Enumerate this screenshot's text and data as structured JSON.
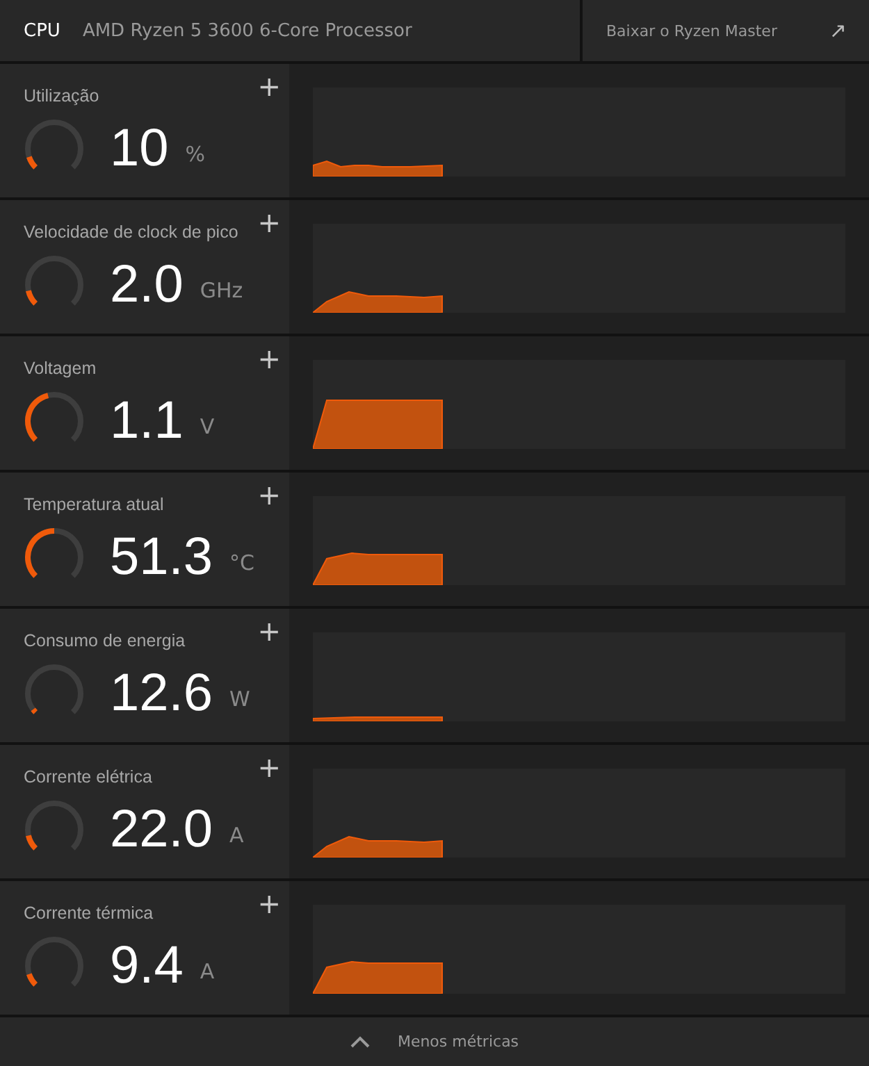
{
  "header": {
    "label": "CPU",
    "processor": "AMD Ryzen 5 3600 6-Core Processor",
    "link": "Baixar o Ryzen Master",
    "link_icon": "↗"
  },
  "metrics": [
    {
      "title": "Utilização",
      "value": "10",
      "unit": "%"
    },
    {
      "title": "Velocidade de clock de pico",
      "value": "2.0",
      "unit": "GHz"
    },
    {
      "title": "Voltagem",
      "value": "1.1",
      "unit": "V"
    },
    {
      "title": "Temperatura atual",
      "value": "51.3",
      "unit": "°C"
    },
    {
      "title": "Consumo de energia",
      "value": "12.6",
      "unit": "W"
    },
    {
      "title": "Corrente elétrica",
      "value": "22.0",
      "unit": "A"
    },
    {
      "title": "Corrente térmica",
      "value": "9.4",
      "unit": "A"
    }
  ],
  "add_icon": "+",
  "footer": {
    "label": "Menos métricas"
  }
}
